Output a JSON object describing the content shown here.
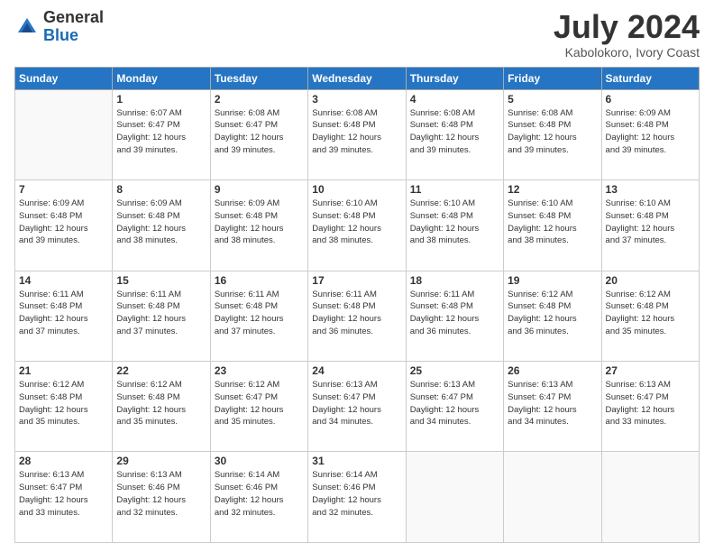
{
  "logo": {
    "general": "General",
    "blue": "Blue"
  },
  "title": "July 2024",
  "location": "Kabolokoro, Ivory Coast",
  "days_of_week": [
    "Sunday",
    "Monday",
    "Tuesday",
    "Wednesday",
    "Thursday",
    "Friday",
    "Saturday"
  ],
  "weeks": [
    [
      {
        "day": "",
        "info": ""
      },
      {
        "day": "1",
        "info": "Sunrise: 6:07 AM\nSunset: 6:47 PM\nDaylight: 12 hours\nand 39 minutes."
      },
      {
        "day": "2",
        "info": "Sunrise: 6:08 AM\nSunset: 6:47 PM\nDaylight: 12 hours\nand 39 minutes."
      },
      {
        "day": "3",
        "info": "Sunrise: 6:08 AM\nSunset: 6:48 PM\nDaylight: 12 hours\nand 39 minutes."
      },
      {
        "day": "4",
        "info": "Sunrise: 6:08 AM\nSunset: 6:48 PM\nDaylight: 12 hours\nand 39 minutes."
      },
      {
        "day": "5",
        "info": "Sunrise: 6:08 AM\nSunset: 6:48 PM\nDaylight: 12 hours\nand 39 minutes."
      },
      {
        "day": "6",
        "info": "Sunrise: 6:09 AM\nSunset: 6:48 PM\nDaylight: 12 hours\nand 39 minutes."
      }
    ],
    [
      {
        "day": "7",
        "info": "Sunrise: 6:09 AM\nSunset: 6:48 PM\nDaylight: 12 hours\nand 39 minutes."
      },
      {
        "day": "8",
        "info": "Sunrise: 6:09 AM\nSunset: 6:48 PM\nDaylight: 12 hours\nand 38 minutes."
      },
      {
        "day": "9",
        "info": "Sunrise: 6:09 AM\nSunset: 6:48 PM\nDaylight: 12 hours\nand 38 minutes."
      },
      {
        "day": "10",
        "info": "Sunrise: 6:10 AM\nSunset: 6:48 PM\nDaylight: 12 hours\nand 38 minutes."
      },
      {
        "day": "11",
        "info": "Sunrise: 6:10 AM\nSunset: 6:48 PM\nDaylight: 12 hours\nand 38 minutes."
      },
      {
        "day": "12",
        "info": "Sunrise: 6:10 AM\nSunset: 6:48 PM\nDaylight: 12 hours\nand 38 minutes."
      },
      {
        "day": "13",
        "info": "Sunrise: 6:10 AM\nSunset: 6:48 PM\nDaylight: 12 hours\nand 37 minutes."
      }
    ],
    [
      {
        "day": "14",
        "info": "Sunrise: 6:11 AM\nSunset: 6:48 PM\nDaylight: 12 hours\nand 37 minutes."
      },
      {
        "day": "15",
        "info": "Sunrise: 6:11 AM\nSunset: 6:48 PM\nDaylight: 12 hours\nand 37 minutes."
      },
      {
        "day": "16",
        "info": "Sunrise: 6:11 AM\nSunset: 6:48 PM\nDaylight: 12 hours\nand 37 minutes."
      },
      {
        "day": "17",
        "info": "Sunrise: 6:11 AM\nSunset: 6:48 PM\nDaylight: 12 hours\nand 36 minutes."
      },
      {
        "day": "18",
        "info": "Sunrise: 6:11 AM\nSunset: 6:48 PM\nDaylight: 12 hours\nand 36 minutes."
      },
      {
        "day": "19",
        "info": "Sunrise: 6:12 AM\nSunset: 6:48 PM\nDaylight: 12 hours\nand 36 minutes."
      },
      {
        "day": "20",
        "info": "Sunrise: 6:12 AM\nSunset: 6:48 PM\nDaylight: 12 hours\nand 35 minutes."
      }
    ],
    [
      {
        "day": "21",
        "info": "Sunrise: 6:12 AM\nSunset: 6:48 PM\nDaylight: 12 hours\nand 35 minutes."
      },
      {
        "day": "22",
        "info": "Sunrise: 6:12 AM\nSunset: 6:48 PM\nDaylight: 12 hours\nand 35 minutes."
      },
      {
        "day": "23",
        "info": "Sunrise: 6:12 AM\nSunset: 6:47 PM\nDaylight: 12 hours\nand 35 minutes."
      },
      {
        "day": "24",
        "info": "Sunrise: 6:13 AM\nSunset: 6:47 PM\nDaylight: 12 hours\nand 34 minutes."
      },
      {
        "day": "25",
        "info": "Sunrise: 6:13 AM\nSunset: 6:47 PM\nDaylight: 12 hours\nand 34 minutes."
      },
      {
        "day": "26",
        "info": "Sunrise: 6:13 AM\nSunset: 6:47 PM\nDaylight: 12 hours\nand 34 minutes."
      },
      {
        "day": "27",
        "info": "Sunrise: 6:13 AM\nSunset: 6:47 PM\nDaylight: 12 hours\nand 33 minutes."
      }
    ],
    [
      {
        "day": "28",
        "info": "Sunrise: 6:13 AM\nSunset: 6:47 PM\nDaylight: 12 hours\nand 33 minutes."
      },
      {
        "day": "29",
        "info": "Sunrise: 6:13 AM\nSunset: 6:46 PM\nDaylight: 12 hours\nand 32 minutes."
      },
      {
        "day": "30",
        "info": "Sunrise: 6:14 AM\nSunset: 6:46 PM\nDaylight: 12 hours\nand 32 minutes."
      },
      {
        "day": "31",
        "info": "Sunrise: 6:14 AM\nSunset: 6:46 PM\nDaylight: 12 hours\nand 32 minutes."
      },
      {
        "day": "",
        "info": ""
      },
      {
        "day": "",
        "info": ""
      },
      {
        "day": "",
        "info": ""
      }
    ]
  ]
}
